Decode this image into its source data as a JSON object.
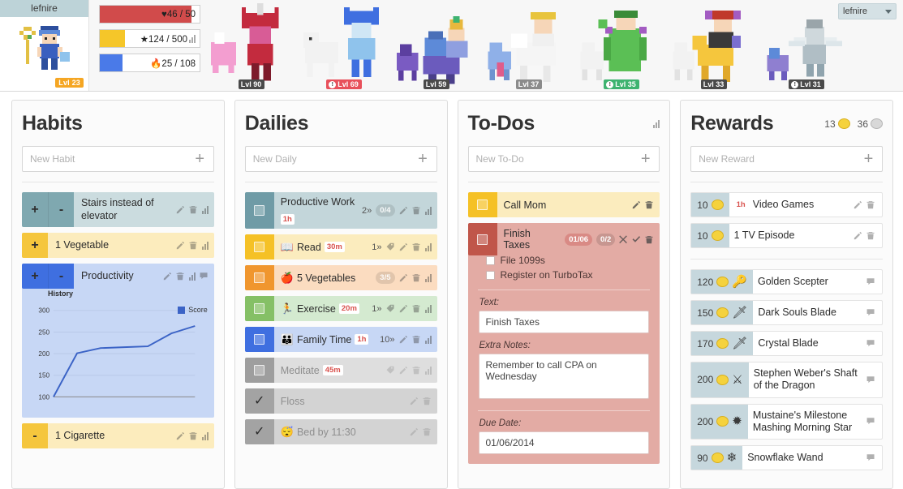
{
  "header": {
    "username": "lefnire",
    "level_badge": "Lvl 23",
    "stats": [
      {
        "name": "health",
        "icon": "heart-icon",
        "glyph": "♥",
        "value": "46 / 50",
        "percent": 92,
        "color": "#d14b4b",
        "has_chart": false
      },
      {
        "name": "experience",
        "icon": "star-icon",
        "glyph": "★",
        "value": "124 / 500",
        "percent": 25,
        "color": "#f5c629",
        "has_chart": true
      },
      {
        "name": "mana",
        "icon": "flame-icon",
        "glyph": "🔥",
        "value": "25 / 108",
        "percent": 23,
        "color": "#4a7ae8",
        "has_chart": false
      }
    ],
    "party": [
      {
        "sprite": "🦄",
        "level": "Lvl 90",
        "style": "dark",
        "bolt": false
      },
      {
        "sprite": "🐱",
        "level": "Lvl 69",
        "style": "red",
        "bolt": true
      },
      {
        "sprite": "🐉",
        "level": "Lvl 59",
        "style": "dark",
        "bolt": false
      },
      {
        "sprite": "🐎",
        "level": "Lvl 37",
        "style": "gray",
        "bolt": false
      },
      {
        "sprite": "🌵",
        "level": "Lvl 35",
        "style": "green",
        "bolt": true
      },
      {
        "sprite": "🦊",
        "level": "Lvl 33",
        "style": "dark",
        "bolt": false
      },
      {
        "sprite": "⚔",
        "level": "Lvl 31",
        "style": "dark",
        "bolt": true
      }
    ],
    "user_select": {
      "value": "lefnire"
    }
  },
  "habits": {
    "title": "Habits",
    "new_placeholder": "New Habit",
    "add_label": "+",
    "items": [
      {
        "text": "Stairs instead of elevator",
        "plus": true,
        "minus": true,
        "btn_color": "#7fa8b0",
        "body_color": "#cbdcdf",
        "icons": [
          "edit-icon",
          "delete-icon",
          "chart-icon"
        ],
        "expanded": false
      },
      {
        "text": "1 Vegetable",
        "plus": true,
        "minus": false,
        "btn_color": "#f5c63d",
        "body_color": "#fcecbd",
        "icons": [
          "edit-icon",
          "delete-icon",
          "chart-icon"
        ],
        "expanded": false
      },
      {
        "text": "Productivity",
        "plus": true,
        "minus": true,
        "btn_color": "#3f6fe0",
        "body_color": "#c7d7f5",
        "icons": [
          "edit-icon",
          "delete-icon",
          "chart-icon",
          "comment-icon"
        ],
        "expanded": true
      },
      {
        "text": "1 Cigarette",
        "plus": false,
        "minus": true,
        "btn_color": "#f5c63d",
        "body_color": "#fcecbd",
        "icons": [
          "edit-icon",
          "delete-icon",
          "chart-icon"
        ],
        "expanded": false
      }
    ]
  },
  "chart_data": {
    "type": "line",
    "title": "History",
    "xlabel": "",
    "ylabel": "",
    "ylim": [
      100,
      300
    ],
    "yticks": [
      100,
      150,
      200,
      250,
      300
    ],
    "grid": true,
    "legend": "right",
    "series": [
      {
        "name": "Score",
        "color": "#3b63c6",
        "x": [
          0,
          1,
          2,
          3,
          4,
          5,
          6
        ],
        "values": [
          100,
          201,
          213,
          215,
          217,
          247,
          264
        ]
      }
    ],
    "legend_entries": [
      "Score"
    ]
  },
  "dailies": {
    "title": "Dailies",
    "new_placeholder": "New Daily",
    "add_label": "+",
    "items": [
      {
        "text": "Productive Work",
        "emoji": "",
        "time": "1h",
        "time_below": true,
        "box_color": "#6f9ba6",
        "body_color": "#c3d6da",
        "streak": "2",
        "counter": "0/4",
        "icons": [
          "edit-icon",
          "delete-icon",
          "chart-icon"
        ],
        "checked": false,
        "dim": false,
        "has_tag": false
      },
      {
        "text": "Read",
        "emoji": "📖",
        "time": "30m",
        "time_below": false,
        "box_color": "#f5c126",
        "body_color": "#fbecbe",
        "streak": "1",
        "counter": "",
        "icons": [
          "tag-icon",
          "edit-icon",
          "delete-icon",
          "chart-icon"
        ],
        "checked": false,
        "dim": false,
        "has_tag": true
      },
      {
        "text": "5 Vegetables",
        "emoji": "🍎",
        "time": "",
        "time_below": false,
        "box_color": "#f0962e",
        "body_color": "#fbdcc0",
        "streak": "",
        "counter": "3/5",
        "icons": [
          "edit-icon",
          "delete-icon",
          "chart-icon"
        ],
        "checked": false,
        "dim": false,
        "has_tag": false
      },
      {
        "text": "Exercise",
        "emoji": "🏃",
        "time": "20m",
        "time_below": false,
        "box_color": "#85c066",
        "body_color": "#d4ead0",
        "streak": "1",
        "counter": "",
        "icons": [
          "tag-icon",
          "edit-icon",
          "delete-icon",
          "chart-icon"
        ],
        "checked": false,
        "dim": false,
        "has_tag": true
      },
      {
        "text": "Family Time",
        "emoji": "👪",
        "time": "1h",
        "time_below": false,
        "box_color": "#3f6fe0",
        "body_color": "#c7d7f5",
        "streak": "10",
        "counter": "",
        "icons": [
          "edit-icon",
          "delete-icon",
          "chart-icon"
        ],
        "checked": false,
        "dim": false,
        "has_tag": false
      },
      {
        "text": "Meditate",
        "emoji": "",
        "time": "45m",
        "time_below": false,
        "box_color": "#9e9e9e",
        "body_color": "#dedede",
        "streak": "",
        "counter": "",
        "icons": [
          "tag-icon",
          "edit-icon",
          "delete-icon",
          "chart-icon"
        ],
        "checked": false,
        "dim": true,
        "has_tag": true
      },
      {
        "text": "Floss",
        "emoji": "",
        "time": "",
        "time_below": false,
        "box_color": "#a3a3a3",
        "body_color": "#d3d3d3",
        "streak": "",
        "counter": "",
        "icons": [
          "edit-icon",
          "delete-icon"
        ],
        "checked": true,
        "dim": true,
        "has_tag": false
      },
      {
        "text": "Bed by 11:30",
        "emoji": "😴",
        "time": "",
        "time_below": false,
        "box_color": "#a3a3a3",
        "body_color": "#d3d3d3",
        "streak": "",
        "counter": "",
        "icons": [
          "edit-icon",
          "delete-icon"
        ],
        "checked": true,
        "dim": true,
        "has_tag": false
      }
    ]
  },
  "todos": {
    "title": "To-Dos",
    "new_placeholder": "New To-Do",
    "add_label": "+",
    "items": [
      {
        "text": "Call Mom",
        "box_color": "#f5c126",
        "body_color": "#fbecbe",
        "due": "",
        "counter": "",
        "icons": [
          "edit-icon",
          "delete-icon"
        ],
        "expanded": false
      },
      {
        "text": "Finish Taxes",
        "box_color": "#c0564a",
        "body_color": "#e3aba4",
        "due": "01/06",
        "counter": "0/2",
        "icons": [
          "close-icon",
          "check-icon",
          "delete-icon"
        ],
        "expanded": true
      }
    ],
    "expanded_detail": {
      "subtasks": [
        {
          "text": "File 1099s",
          "checked": false
        },
        {
          "text": "Register on TurboTax",
          "checked": false
        }
      ],
      "text_label": "Text:",
      "text_value": "Finish Taxes",
      "notes_label": "Extra Notes:",
      "notes_value": "Remember to call CPA on Wednesday",
      "due_label": "Due Date:",
      "due_value": "01/06/2014"
    }
  },
  "rewards": {
    "title": "Rewards",
    "new_placeholder": "New Reward",
    "add_label": "+",
    "gold": "13",
    "silver": "36",
    "custom": [
      {
        "cost": "10",
        "time": "1h",
        "text": "Video Games",
        "sprite": "",
        "icons": [
          "edit-icon",
          "delete-icon"
        ]
      },
      {
        "cost": "10",
        "time": "",
        "text": "1 TV Episode",
        "sprite": "",
        "icons": [
          "edit-icon",
          "delete-icon"
        ]
      }
    ],
    "shop": [
      {
        "cost": "120",
        "text": "Golden Scepter",
        "sprite": "🔑",
        "icons": [
          "comment-icon"
        ]
      },
      {
        "cost": "150",
        "text": "Dark Souls Blade",
        "sprite": "🗡",
        "icons": [
          "comment-icon"
        ]
      },
      {
        "cost": "170",
        "text": "Crystal Blade",
        "sprite": "🗡",
        "icons": [
          "comment-icon"
        ]
      },
      {
        "cost": "200",
        "text": "Stephen Weber's Shaft of the Dragon",
        "sprite": "⚔",
        "icons": [
          "comment-icon"
        ]
      },
      {
        "cost": "200",
        "text": "Mustaine's Milestone Mashing Morning Star",
        "sprite": "✹",
        "icons": [
          "comment-icon"
        ]
      },
      {
        "cost": "90",
        "text": "Snowflake Wand",
        "sprite": "❄",
        "icons": [
          "comment-icon"
        ]
      }
    ]
  }
}
